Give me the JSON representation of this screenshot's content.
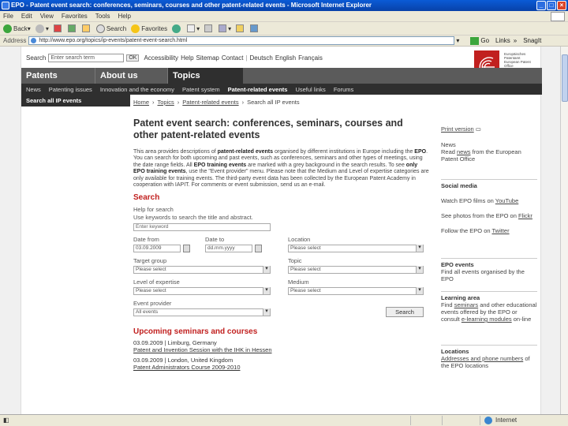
{
  "window": {
    "title": "EPO - Patent event search: conferences, seminars, courses and other patent-related events - Microsoft Internet Explorer"
  },
  "menubar": [
    "File",
    "Edit",
    "View",
    "Favorites",
    "Tools",
    "Help"
  ],
  "toolbar": {
    "back": "Back",
    "search": "Search",
    "favorites": "Favorites"
  },
  "addressbar": {
    "label": "Address",
    "url": "http://www.epo.org/topics/ip-events/patent-event-search.html",
    "go": "Go",
    "links": "Links",
    "snagit": "SnagIt"
  },
  "topsearch": {
    "label": "Search",
    "placeholder": "Enter search term",
    "ok": "OK",
    "links": [
      "Accessibility",
      "Help",
      "Sitemap",
      "Contact"
    ],
    "langs": [
      "Deutsch",
      "English",
      "Français"
    ]
  },
  "logo": {
    "lines": [
      "Europäisches Patentamt",
      "European Patent Office",
      "Office européen des brevets"
    ]
  },
  "mainnav": [
    "Patents",
    "About us",
    "Topics"
  ],
  "subnav": [
    "News",
    "Patenting issues",
    "Innovation and the economy",
    "Patent system",
    "Patent-related events",
    "Useful links",
    "Forums"
  ],
  "leftnav": {
    "item": "Search all IP events"
  },
  "breadcrumb": [
    "Home",
    "Topics",
    "Patent-related events",
    "Search all IP events"
  ],
  "main": {
    "title": "Patent event search: conferences, seminars, courses and other patent-related events",
    "intro_parts": {
      "p1": "This area provides descriptions of ",
      "b1": "patent-related events",
      "p2": " organised by different institutions in Europe including the ",
      "b2": "EPO",
      "p3": ". You can search for both upcoming and past events, such as conferences, seminars and other types of meetings, using the date range fields. All ",
      "b3": "EPO training events",
      "p4": " are marked with a grey background in the search results. To see ",
      "b4": "only EPO training events",
      "p5": ", use the \"Event provider\" menu. Please note that the Medium and Level of expertise categories are only available for training events. The third-party event data has been collected by the European Patent Academy in cooperation with IAPIT. For comments or event submission, send us an e-mail."
    },
    "search": {
      "heading": "Search",
      "help_label": "Help for search",
      "help_text": "Use keywords to search the title and abstract.",
      "keyword_placeholder": "Enter keyword",
      "date_from_label": "Date from",
      "date_from_value": "03.09.2009",
      "date_to_label": "Date to",
      "date_to_value": "dd.mm.yyyy",
      "location_label": "Location",
      "location_value": "Please select",
      "target_group_label": "Target group",
      "target_group_value": "Please select",
      "topic_label": "Topic",
      "topic_value": "Please select",
      "level_label": "Level of expertise",
      "level_value": "Please select",
      "medium_label": "Medium",
      "medium_value": "Please select",
      "provider_label": "Event provider",
      "provider_value": "All events",
      "button": "Search"
    },
    "upcoming": {
      "heading": "Upcoming seminars and courses",
      "events": [
        {
          "meta": "03.09.2009 | Limburg, Germany",
          "title": "Patent and Invention Session with the IHK in Hessen"
        },
        {
          "meta": "03.09.2009 | London, United Kingdom",
          "title": "Patent Administrators Course 2009-2010"
        }
      ]
    }
  },
  "sidebar": {
    "print": "Print version",
    "news": {
      "heading": "News",
      "pre": "Read ",
      "link": "news",
      "post": " from the European Patent Office"
    },
    "social": {
      "heading": "Social media",
      "youtube_pre": "Watch EPO films on ",
      "youtube_link": "YouTube",
      "flickr_pre": "See photos from the EPO on ",
      "flickr_link": "Flickr",
      "twitter_pre": "Follow the EPO on ",
      "twitter_link": "Twitter"
    },
    "epo_events": {
      "heading": "EPO events",
      "text": "Find all events organised by the EPO"
    },
    "learning": {
      "heading": "Learning area",
      "pre": "Find ",
      "link1": "seminars",
      "mid": " and other educational events offered by the EPO or consult ",
      "link2": "e-learning modules",
      "post": " on-line"
    },
    "locations": {
      "heading": "Locations",
      "link": "Addresses and phone numbers",
      "post": " of the EPO locations"
    }
  },
  "statusbar": {
    "zone": "Internet"
  }
}
